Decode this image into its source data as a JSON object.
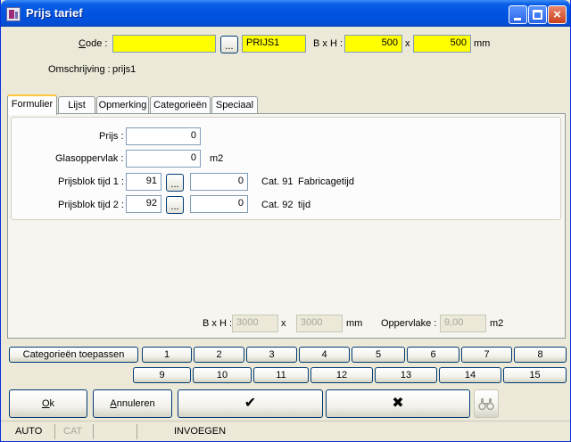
{
  "window": {
    "title": "Prijs tarief"
  },
  "header": {
    "code_label_u": "C",
    "code_label_rest": "ode :",
    "code_value": "",
    "code_button": "...",
    "code_name": "PRIJS1",
    "bxh_label": "B x H :",
    "width": "500",
    "x_sep": "x",
    "height": "500",
    "unit": "mm",
    "omschrijving_label": "Omschrijving :",
    "omschrijving_value": "prijs1"
  },
  "tabs": [
    {
      "label": "Formulier",
      "active": true
    },
    {
      "label": "Lijst",
      "active": false
    },
    {
      "label": "Opmerking",
      "active": false
    },
    {
      "label": "Categorieën",
      "active": false
    },
    {
      "label": "Speciaal",
      "active": false
    }
  ],
  "form": {
    "prijs_label": "Prijs :",
    "prijs_value": "0",
    "glas_label": "Glasoppervlak :",
    "glas_value": "0",
    "glas_unit": "m2",
    "blok1_label": "Prijsblok tijd 1 :",
    "blok1_num": "91",
    "blok1_button": "...",
    "blok1_value": "0",
    "blok1_cat": "Cat. 91",
    "blok1_desc": "Fabricagetijd",
    "blok2_label": "Prijsblok tijd 2 :",
    "blok2_num": "92",
    "blok2_button": "...",
    "blok2_value": "0",
    "blok2_cat": "Cat. 92",
    "blok2_desc": "tijd"
  },
  "bottom_info": {
    "bxh_label": "B x H :",
    "width": "3000",
    "x_sep": "x",
    "height": "3000",
    "unit": "mm",
    "opp_label": "Oppervlake :",
    "opp_value": "9,00",
    "opp_unit": "m2"
  },
  "category_buttons": {
    "apply_label": "Categorieën toepassen",
    "row1": [
      "1",
      "2",
      "3",
      "4",
      "5",
      "6",
      "7",
      "8"
    ],
    "row2": [
      "9",
      "10",
      "11",
      "12",
      "13",
      "14",
      "15"
    ]
  },
  "actions": {
    "ok_u": "O",
    "ok_rest": "k",
    "cancel_u": "A",
    "cancel_rest": "nnuleren",
    "confirm_symbol": "✔",
    "reject_symbol": "✖",
    "search_icon": "binoculars-icon"
  },
  "status": {
    "mode": "AUTO",
    "cat": "CAT",
    "empty": "",
    "action": "INVOEGEN"
  }
}
